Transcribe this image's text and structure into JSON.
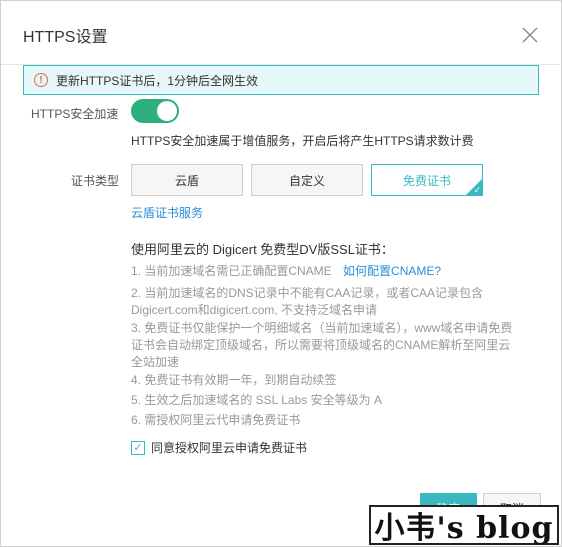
{
  "dialog": {
    "title": "HTTPS设置"
  },
  "alert": {
    "icon": "exclamation-circle-icon",
    "text": "更新HTTPS证书后，1分钟后全网生效"
  },
  "https_accel": {
    "label": "HTTPS安全加速",
    "enabled": true,
    "hint": "HTTPS安全加速属于增值服务，开启后将产生HTTPS请求数计费"
  },
  "cert_type": {
    "label": "证书类型",
    "options": [
      "云盾",
      "自定义",
      "免费证书"
    ],
    "selected": "免费证书",
    "service_link": "云盾证书服务"
  },
  "notes": {
    "title": "使用阿里云的 Digicert 免费型DV版SSL证书：",
    "items": [
      {
        "lines": [
          "1. 当前加速域名需已正确配置CNAME"
        ],
        "link": "如何配置CNAME?"
      },
      {
        "lines": [
          "2. 当前加速域名的DNS记录中不能有CAA记录，或者CAA记录包含",
          "Digicert.com和digicert.com, 不支持泛域名申请"
        ]
      },
      {
        "lines": [
          "3. 免费证书仅能保护一个明细域名（当前加速域名），www域名申请免费",
          "证书会自动绑定顶级域名，所以需要将顶级域名的CNAME解析至阿里云",
          "全站加速"
        ]
      },
      {
        "lines": [
          "4. 免费证书有效期一年，到期自动续签"
        ]
      },
      {
        "lines": [
          "5. 生效之后加速域名的 SSL Labs 安全等级为 A"
        ]
      },
      {
        "lines": [
          "6. 需授权阿里云代申请免费证书"
        ]
      }
    ]
  },
  "agree": {
    "checked": true,
    "label": "同意授权阿里云申请免费证书"
  },
  "footer": {
    "ok": "确定",
    "cancel": "取消"
  },
  "watermark": "小韦's blog",
  "colors": {
    "accent": "#39b9c3",
    "toggle_on": "#2eb07e",
    "link": "#2b8fd4",
    "warning": "#e8615a"
  }
}
